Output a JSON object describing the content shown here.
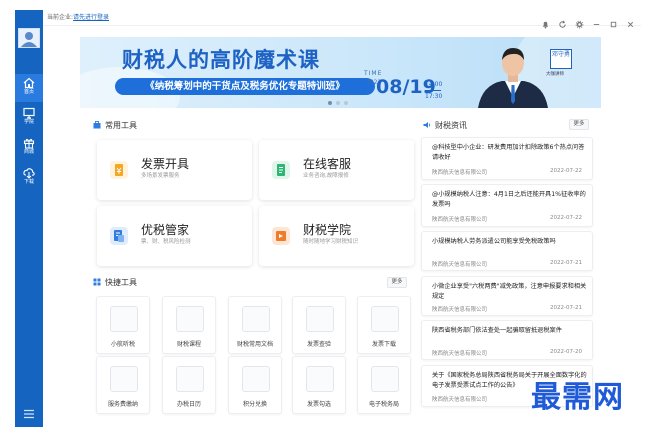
{
  "header": {
    "company_prefix": "当前企业:",
    "login_link": "请先进行登录"
  },
  "sidebar": {
    "items": [
      {
        "label": "首页",
        "icon": "home-icon"
      },
      {
        "label": "学院",
        "icon": "monitor-icon"
      },
      {
        "label": "商城",
        "icon": "gift-icon"
      },
      {
        "label": "下载",
        "icon": "download-icon"
      }
    ]
  },
  "banner": {
    "title": "财税人的高阶魔术课",
    "subtitle": "《纳税筹划中的干货点及税务优化专题特训班》",
    "time_label": "TIME",
    "year": "2022",
    "date": "08/19",
    "time_start": "14:00",
    "time_end": "17:30",
    "presenter_name": "邓守勇",
    "presenter_title": "大咖讲师"
  },
  "common_tools": {
    "title": "常用工具",
    "cards": [
      {
        "title": "发票开具",
        "desc": "多场景发票服务",
        "color": "#f5a623"
      },
      {
        "title": "在线客服",
        "desc": "业务咨询,故障报修",
        "color": "#2bb673"
      },
      {
        "title": "优税管家",
        "desc": "票、财、税风险检测",
        "color": "#2f7de1"
      },
      {
        "title": "财税学院",
        "desc": "随时随地学习财税知识",
        "color": "#f07b28"
      }
    ]
  },
  "quick_tools": {
    "title": "快捷工具",
    "more": "更多",
    "items": [
      {
        "label": "小航听税"
      },
      {
        "label": "财税课程"
      },
      {
        "label": "财税常用文档"
      },
      {
        "label": "发票查验"
      },
      {
        "label": "发票下载"
      },
      {
        "label": "服务费缴纳"
      },
      {
        "label": "办税日历"
      },
      {
        "label": "积分兑换"
      },
      {
        "label": "发票勾选"
      },
      {
        "label": "电子税务局"
      }
    ]
  },
  "news": {
    "title": "财税资讯",
    "more": "更多",
    "items": [
      {
        "title": "@科技型中小企业：研发费用加计扣除政策6个热点问答请收好",
        "source": "陕西航天信息有限公司",
        "date": "2022-07-22"
      },
      {
        "title": "@小规模纳税人注意：4月1日之后还能开具1%征收率的发票吗",
        "source": "陕西航天信息有限公司",
        "date": "2022-07-22"
      },
      {
        "title": "小规模纳税人劳务派遣公司能享受免税政策吗",
        "source": "陕西航天信息有限公司",
        "date": "2022-07-21"
      },
      {
        "title": "小微企业享受\"六税两费\"减免政策，注意申报要求和相关规定",
        "source": "陕西航天信息有限公司",
        "date": "2022-07-21"
      },
      {
        "title": "陕西省税务部门依法查处一起骗取留抵退税案件",
        "source": "陕西航天信息有限公司",
        "date": "2022-07-20"
      },
      {
        "title": "关于《国家税务总局陕西省税务局关于开展全面数字化的电子发票受票试点工作的公告》",
        "source": "陕西航天信息有限公司",
        "date": ""
      }
    ]
  },
  "watermark": "最需网",
  "colors": {
    "sidebar": "#1565c0",
    "accent": "#1e63c4"
  }
}
